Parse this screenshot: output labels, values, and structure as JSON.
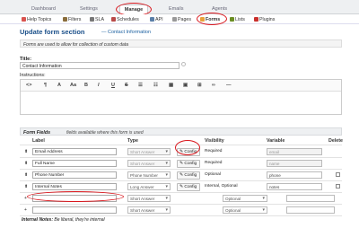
{
  "topnav": {
    "tabs": [
      {
        "label": "Dashboard"
      },
      {
        "label": "Settings"
      },
      {
        "label": "Manage"
      },
      {
        "label": "Emails"
      },
      {
        "label": "Agents"
      }
    ]
  },
  "subnav": {
    "items": [
      {
        "label": "Help Topics",
        "icon": "help-icon"
      },
      {
        "label": "Filters",
        "icon": "filter-icon"
      },
      {
        "label": "SLA",
        "icon": "sla-icon"
      },
      {
        "label": "Schedules",
        "icon": "calendar-icon"
      },
      {
        "label": "API",
        "icon": "api-icon"
      },
      {
        "label": "Pages",
        "icon": "page-icon"
      },
      {
        "label": "Forms",
        "icon": "forms-icon"
      },
      {
        "label": "Lists",
        "icon": "list-icon"
      },
      {
        "label": "Plugins",
        "icon": "plugin-icon"
      }
    ]
  },
  "header": {
    "title": "Update form section",
    "link": "— Contact Information"
  },
  "notice": "Forms are used to allow for collection of custom data",
  "form": {
    "title_label": "Title:",
    "title_value": "Contact Information",
    "instructions_label": "Instructions:"
  },
  "editor": {
    "toolbar": [
      "<>",
      "¶",
      "A",
      "Aa",
      "B",
      "I",
      "U",
      "S",
      "☰",
      "☷",
      "▦",
      "▣",
      "⊞",
      "∞",
      "—"
    ]
  },
  "fields": {
    "section_title": "Form Fields",
    "section_sub": "fields available where this form is used",
    "headers": {
      "label": "Label",
      "type": "Type",
      "visibility": "Visibility",
      "variable": "Variable",
      "delete": "Delete"
    },
    "rows": [
      {
        "label": "Email Address",
        "type": "Short Answer",
        "config": "Config",
        "visibility": "Required",
        "variable": "email",
        "editable": false
      },
      {
        "label": "Full Name",
        "type": "Short Answer",
        "config": "Config",
        "visibility": "Required",
        "variable": "name",
        "editable": false
      },
      {
        "label": "Phone Number",
        "type": "Phone Number",
        "config": "Config",
        "visibility": "Optional",
        "variable": "phone",
        "editable": true
      },
      {
        "label": "Internal Notes",
        "type": "Long Answer",
        "config": "Config",
        "visibility": "Internal, Optional",
        "variable": "notes",
        "editable": true
      },
      {
        "label": "",
        "type": "Short Answer",
        "visibility": "Optional",
        "variable": ""
      },
      {
        "label": "",
        "type": "Short Answer",
        "visibility": "Optional",
        "variable": ""
      }
    ]
  },
  "footer": {
    "bold": "Internal Notes:",
    "text": "Be liberal, they're internal"
  },
  "colors": {
    "accent": "#1a4f89",
    "annotation": "#d9181e"
  }
}
